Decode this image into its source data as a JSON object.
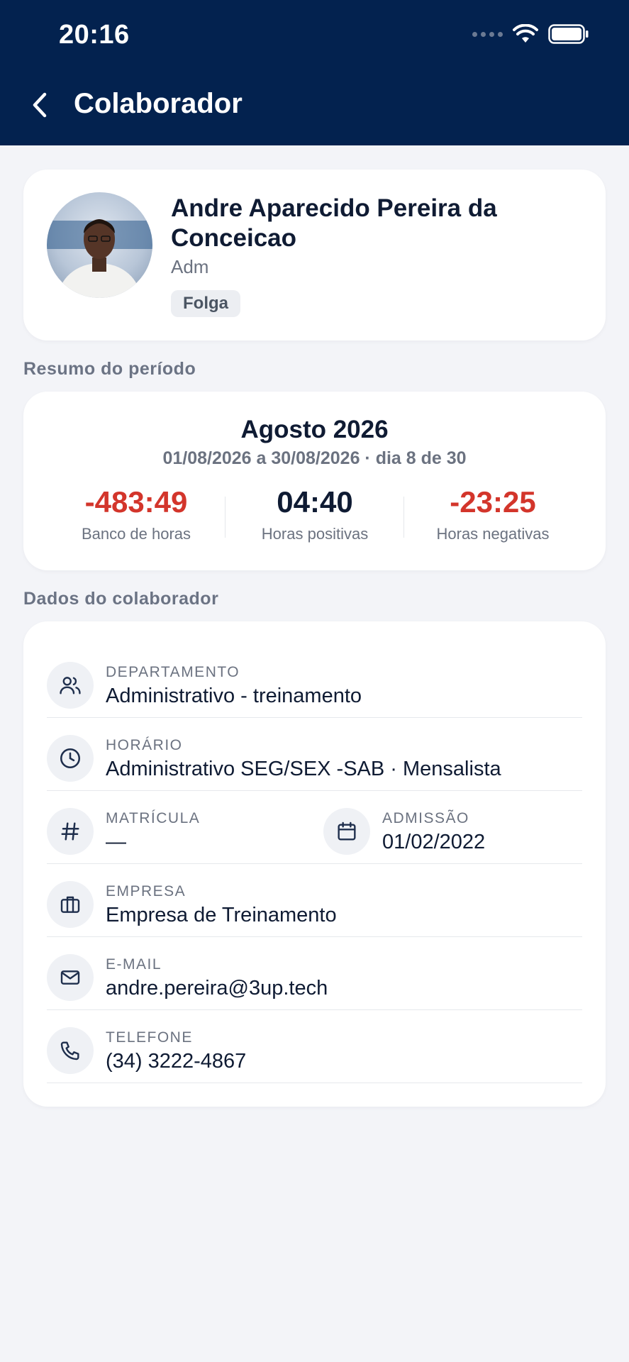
{
  "status_bar": {
    "time": "20:16"
  },
  "nav": {
    "title": "Colaborador"
  },
  "profile": {
    "name": "Andre Aparecido Pereira da Conceicao",
    "role": "Adm",
    "badge": "Folga"
  },
  "summary": {
    "section_title": "Resumo do período",
    "month": "Agosto 2026",
    "range": "01/08/2026 a 30/08/2026 · dia 8 de 30",
    "stats": [
      {
        "value": "-483:49",
        "label": "Banco de horas",
        "negative": true
      },
      {
        "value": "04:40",
        "label": "Horas positivas",
        "negative": false
      },
      {
        "value": "-23:25",
        "label": "Horas negativas",
        "negative": true
      }
    ]
  },
  "details": {
    "section_title": "Dados do colaborador",
    "department": {
      "label": "DEPARTAMENTO",
      "value": "Administrativo - treinamento",
      "icon": "users-icon"
    },
    "schedule": {
      "label": "HORÁRIO",
      "value": "Administrativo SEG/SEX -SAB · Mensalista",
      "icon": "clock-icon"
    },
    "registration": {
      "label": "MATRÍCULA",
      "value": "—",
      "icon": "hash-icon"
    },
    "admission": {
      "label": "ADMISSÃO",
      "value": "01/02/2022",
      "icon": "calendar-icon"
    },
    "company": {
      "label": "EMPRESA",
      "value": "Empresa de Treinamento",
      "icon": "briefcase-icon"
    },
    "email": {
      "label": "E-MAIL",
      "value": "andre.pereira@3up.tech",
      "icon": "mail-icon"
    },
    "phone": {
      "label": "TELEFONE",
      "value": "(34) 3222-4867",
      "icon": "phone-icon"
    }
  },
  "colors": {
    "header": "#03224f",
    "negative": "#d3352b",
    "background": "#f3f4f8"
  }
}
